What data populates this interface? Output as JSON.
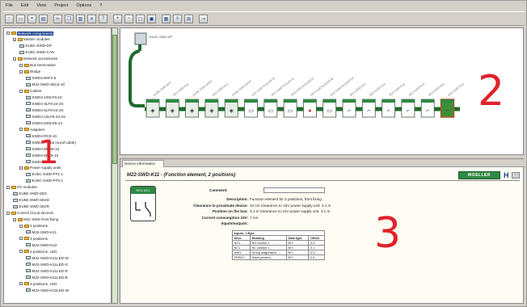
{
  "menu": [
    "File",
    "Edit",
    "View",
    "Project",
    "Options",
    "?"
  ],
  "toolbar_icons": [
    "new-icon",
    "open-icon",
    "save-icon",
    "print-icon",
    "cut-icon",
    "copy-icon",
    "paste-icon",
    "delete-icon",
    "help-icon",
    "zoom-in-icon",
    "zoom-out-icon",
    "zoom-fit-icon",
    "zoom-100-icon",
    "grid-icon",
    "list-icon",
    "tree-icon",
    "connect-icon"
  ],
  "tree": [
    {
      "label": "Network components",
      "level": 0,
      "kind": "fold",
      "sel": true
    },
    {
      "label": "Master modules",
      "level": 1,
      "kind": "fold"
    },
    {
      "label": "EU5C-SWD-DP",
      "level": 2,
      "kind": "dev"
    },
    {
      "label": "EU5C-SWD-CAN",
      "level": 2,
      "kind": "dev"
    },
    {
      "label": "Network accessories",
      "level": 1,
      "kind": "fold"
    },
    {
      "label": "Bus termination",
      "level": 2,
      "kind": "fold"
    },
    {
      "label": "Bridge",
      "level": 2,
      "kind": "fold"
    },
    {
      "label": "SWD4-8SF2-5",
      "level": 3,
      "kind": "dev"
    },
    {
      "label": "M22-SWD-SEL8-10",
      "level": 3,
      "kind": "dev"
    },
    {
      "label": "Cables",
      "level": 2,
      "kind": "fold"
    },
    {
      "label": "SWD4-100LF8-24",
      "level": 3,
      "kind": "dev"
    },
    {
      "label": "SWD4-3LF8-24-2S",
      "level": 3,
      "kind": "dev"
    },
    {
      "label": "SWD4-5LF8-24-2S",
      "level": 3,
      "kind": "dev"
    },
    {
      "label": "SWD4-10LF8-24-2S",
      "level": 3,
      "kind": "dev"
    },
    {
      "label": "SWD4-500LR5-24",
      "level": 3,
      "kind": "dev"
    },
    {
      "label": "Adapters",
      "level": 2,
      "kind": "fold"
    },
    {
      "label": "SWD4-RC8-10",
      "level": 3,
      "kind": "dev"
    },
    {
      "label": "SWD4-... (flat round cable)",
      "level": 3,
      "kind": "dev"
    },
    {
      "label": "SWD4-8MR8-10",
      "level": 3,
      "kind": "dev"
    },
    {
      "label": "SWD4-8FR5-10",
      "level": 3,
      "kind": "dev"
    },
    {
      "label": "SWD4-8SF2-5",
      "level": 3,
      "kind": "dev"
    },
    {
      "label": "Power supply units",
      "level": 2,
      "kind": "fold"
    },
    {
      "label": "EU5C-SWD-PF1-1",
      "level": 3,
      "kind": "dev"
    },
    {
      "label": "EU5C-SWD-PF2-1",
      "level": 3,
      "kind": "dev"
    },
    {
      "label": "I/O modules",
      "level": 0,
      "kind": "fold"
    },
    {
      "label": "EU5E-SWD-8DX",
      "level": 1,
      "kind": "dev"
    },
    {
      "label": "EU5E-SWD-4D4D",
      "level": 1,
      "kind": "dev"
    },
    {
      "label": "EU5E-SWD-4D2R",
      "level": 1,
      "kind": "dev"
    },
    {
      "label": "Control circuit devices",
      "level": 0,
      "kind": "fold"
    },
    {
      "label": "M22 SWD front fixing",
      "level": 1,
      "kind": "fold"
    },
    {
      "label": "2 positions",
      "level": 2,
      "kind": "fold"
    },
    {
      "label": "M22-SWD-K11",
      "level": 3,
      "kind": "dev"
    },
    {
      "label": "3 positions",
      "level": 2,
      "kind": "fold"
    },
    {
      "label": "M22-SWD-K22",
      "level": 3,
      "kind": "dev"
    },
    {
      "label": "2 positions, LED",
      "level": 2,
      "kind": "fold"
    },
    {
      "label": "M22-SWD-K11LED-W",
      "level": 3,
      "kind": "dev"
    },
    {
      "label": "M22-SWD-K11LED-G",
      "level": 3,
      "kind": "dev"
    },
    {
      "label": "M22-SWD-K11LED-R",
      "level": 3,
      "kind": "dev"
    },
    {
      "label": "M22-SWD-K11LED-B",
      "level": 3,
      "kind": "dev"
    },
    {
      "label": "3 positions, LED",
      "level": 2,
      "kind": "fold"
    },
    {
      "label": "M22-SWD-K22LED-W",
      "level": 3,
      "kind": "dev"
    }
  ],
  "topology": {
    "master_label": "EU5C-SWD-DP",
    "device_labels": [
      "EU5E-SWD-8DX",
      "M22-SWD-K11",
      "EU5E-SWD-4D4D",
      "M22-SWD-K22",
      "EU5E-SWD-4D2R",
      "M22-SWD-K11LED-W",
      "M22-SWD-K11LED-G",
      "M22-SWD-K11LED-R",
      "M22-SWD-K11LED-B",
      "M22-SWD-K22LED-W",
      "M22-SWD-K11",
      "M22-SWD-K11",
      "M22-SWD-K11",
      "M22-SWD-K11",
      "M22-SWD-K11",
      "M22-SWD-K11"
    ]
  },
  "detail": {
    "tab": "Device information",
    "title": "M22-SWD-K11 - (Function element, 2 positions)",
    "brand": "MOELLER",
    "card_header": "NO1 NC1",
    "comment_label": "Comment:",
    "fields": [
      {
        "label": "Description:",
        "value": "Function element for 2 positions, front fixing"
      },
      {
        "label": "Clearance to proximate device:",
        "value": "10 cm  Clearance to 15V power supply unit: 3.1 m"
      },
      {
        "label": "Position on the bus:",
        "value": "3.1 m  Clearance to 24V power supply unit: 3.1 m"
      },
      {
        "label": "Current consumption 15V:",
        "value": "7 mA"
      },
      {
        "label": "Inputs/outputs:",
        "value": ""
      }
    ],
    "io_title": "Inputs: 1 Byte",
    "io_headers": [
      "Desc.",
      "Meaning",
      "Data type",
      "Offset"
    ],
    "io_rows": [
      [
        "NO1",
        "NO contact 1",
        "BIT",
        "0.0"
      ],
      [
        "NC1",
        "NC contact 1",
        "BIT",
        "0.1"
      ],
      [
        "DiaG",
        "Group diagnostics",
        "BIT",
        "0.4"
      ],
      [
        "PRSNT",
        "Slave present",
        "BIT",
        "0.6"
      ]
    ]
  },
  "callouts": [
    "1",
    "2",
    "3"
  ],
  "colors": {
    "bus": "#1d6a2b",
    "module_green": "#2d8a43",
    "callout": "#e0222b",
    "selection": "#1b3f8f"
  }
}
